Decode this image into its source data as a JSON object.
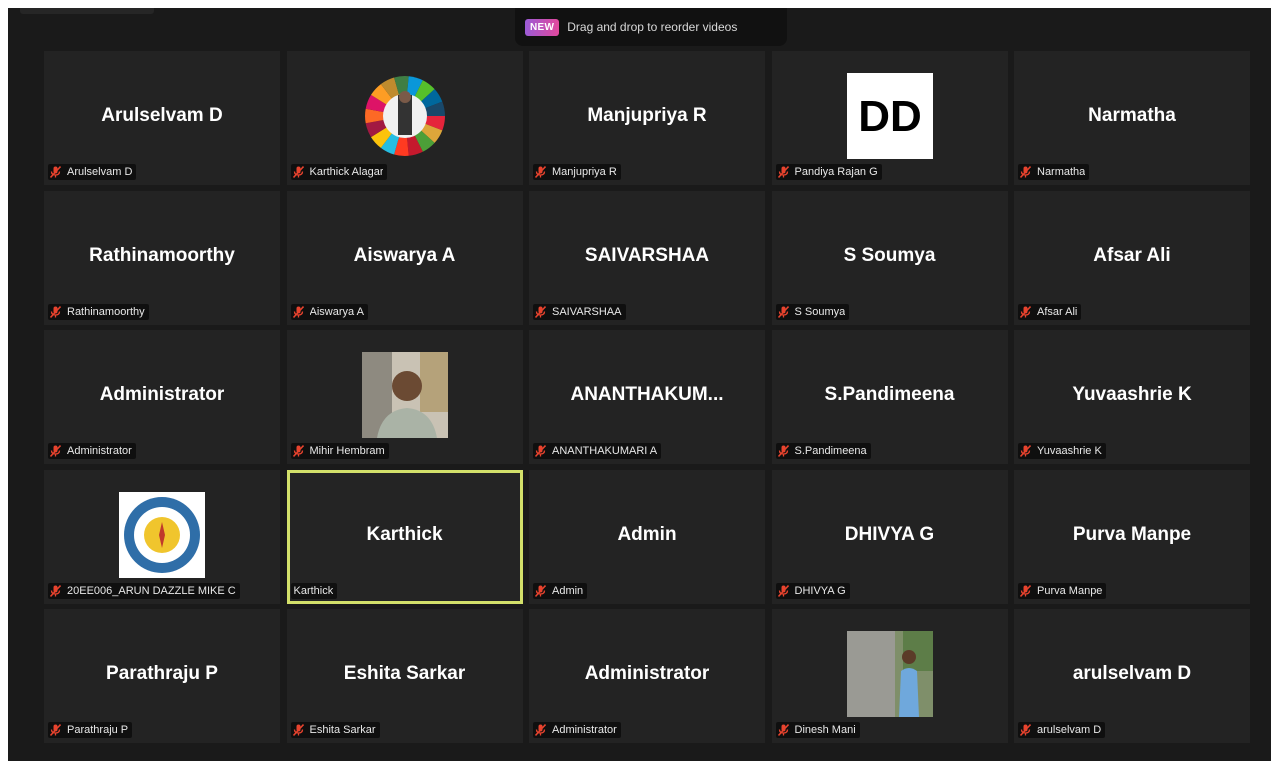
{
  "toast": {
    "badge": "NEW",
    "text": "Drag and drop to reorder videos"
  },
  "tiles": [
    {
      "name": "Arulselvam D",
      "label": "Arulselvam D"
    },
    {
      "name": "",
      "label": "Karthick Alagar",
      "avatar": "sdg-wheel-photo"
    },
    {
      "name": "Manjupriya R",
      "label": "Manjupriya R"
    },
    {
      "name": "",
      "label": "Pandiya Rajan G",
      "avatar": "dd-logo",
      "avatar_text": "DD"
    },
    {
      "name": "Narmatha",
      "label": "Narmatha"
    },
    {
      "name": "Rathinamoorthy",
      "label": "Rathinamoorthy"
    },
    {
      "name": "Aiswarya A",
      "label": "Aiswarya A"
    },
    {
      "name": "SAIVARSHAA",
      "label": "SAIVARSHAA"
    },
    {
      "name": "S Soumya",
      "label": "S Soumya"
    },
    {
      "name": "Afsar Ali",
      "label": "Afsar Ali"
    },
    {
      "name": "Administrator",
      "label": "Administrator"
    },
    {
      "name": "",
      "label": "Mihir Hembram",
      "avatar": "person-photo"
    },
    {
      "name": "ANANTHAKUM...",
      "label": "ANANTHAKUMARI A"
    },
    {
      "name": "S.Pandimeena",
      "label": "S.Pandimeena"
    },
    {
      "name": "Yuvaashrie K",
      "label": "Yuvaashrie K"
    },
    {
      "name": "",
      "label": "20EE006_ARUN DAZZLE MIKE C",
      "avatar": "department-seal"
    },
    {
      "name": "Karthick",
      "label": "Karthick",
      "active": true,
      "muted": false
    },
    {
      "name": "Admin",
      "label": "Admin"
    },
    {
      "name": "DHIVYA G",
      "label": "DHIVYA G"
    },
    {
      "name": "Purva Manpe",
      "label": "Purva Manpe"
    },
    {
      "name": "Parathraju P",
      "label": "Parathraju P"
    },
    {
      "name": "Eshita Sarkar",
      "label": "Eshita Sarkar"
    },
    {
      "name": "Administrator",
      "label": "Administrator"
    },
    {
      "name": "",
      "label": "Dinesh Mani",
      "avatar": "outdoor-person-photo"
    },
    {
      "name": "arulselvam D",
      "label": "arulselvam D"
    }
  ],
  "colors": {
    "background": "#1a1a1a",
    "tile": "#232323",
    "active_border": "#d3e06a",
    "muted_mic": "#e8432e"
  }
}
